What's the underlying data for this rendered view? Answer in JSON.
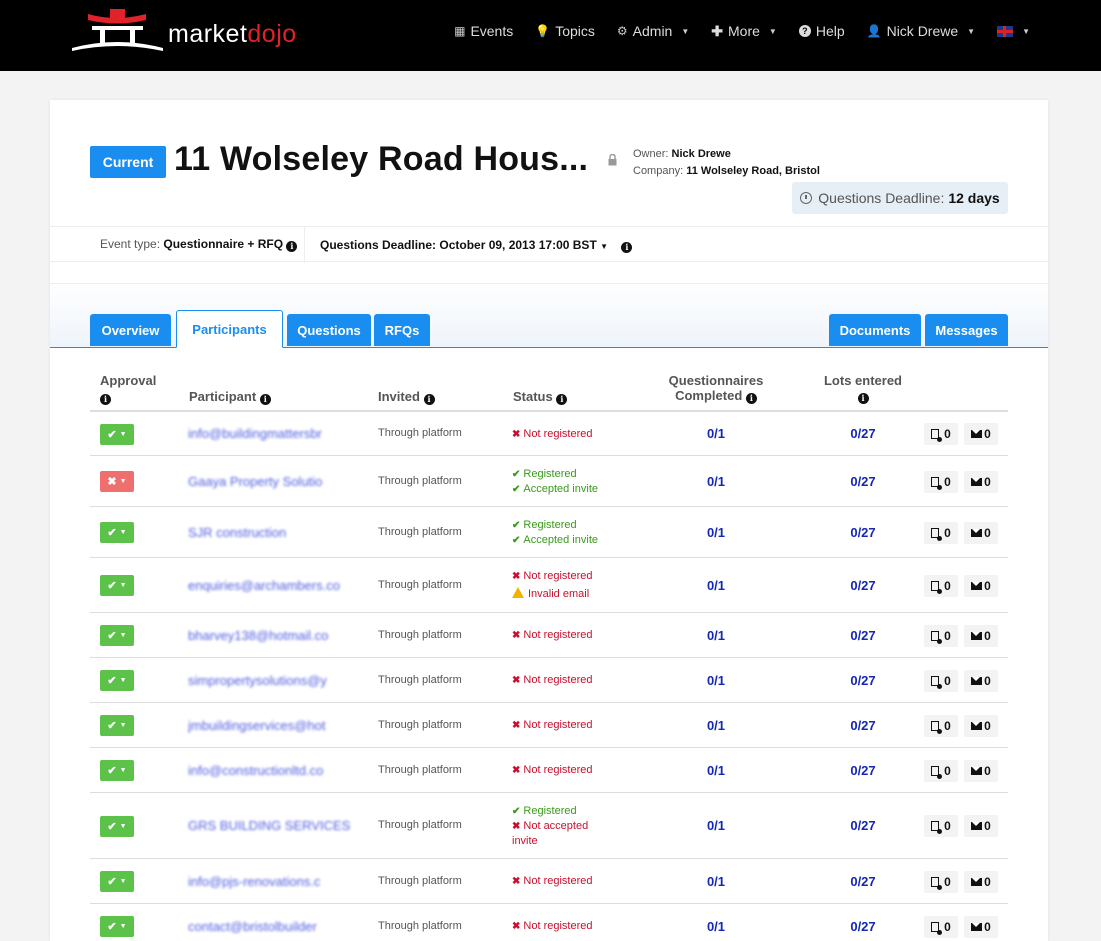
{
  "brand": {
    "name_part1": "market",
    "name_part2": "dojo"
  },
  "nav": {
    "events": "Events",
    "topics": "Topics",
    "admin": "Admin",
    "more": "More",
    "help": "Help",
    "user": "Nick Drewe"
  },
  "event": {
    "state_badge": "Current",
    "title": "11 Wolseley Road Hous...",
    "owner_label": "Owner:",
    "owner": "Nick Drewe",
    "company_label": "Company:",
    "company": "11 Wolseley Road, Bristol",
    "deadline_pill_label": "Questions Deadline:",
    "deadline_pill_value": "12 days",
    "type_label": "Event type:",
    "type_value": "Questionnaire + RFQ",
    "deadline_full": "Questions Deadline: October 09, 2013 17:00 BST"
  },
  "tabs": {
    "overview": "Overview",
    "participants": "Participants",
    "questions": "Questions",
    "rfqs": "RFQs",
    "documents": "Documents",
    "messages": "Messages"
  },
  "table": {
    "headers": {
      "approval": "Approval",
      "participant": "Participant",
      "invited": "Invited",
      "status": "Status",
      "questionnaires_1": "Questionnaires",
      "questionnaires_2": "Completed",
      "lots": "Lots entered"
    },
    "rows": [
      {
        "name": "info@buildingmattersbr",
        "invited": "Through platform",
        "status1": "Not registered",
        "status2": "",
        "status3": "",
        "q": "0/1",
        "lots": "0/27",
        "docs": "0",
        "msgs": "0"
      },
      {
        "name": "Gaaya Property Solutio",
        "invited": "Through platform",
        "status1": "Registered",
        "status2": "Accepted invite",
        "status3": "",
        "q": "0/1",
        "lots": "0/27",
        "docs": "0",
        "msgs": "0"
      },
      {
        "name": "SJR construction",
        "invited": "Through platform",
        "status1": "Registered",
        "status2": "Accepted invite",
        "status3": "",
        "q": "0/1",
        "lots": "0/27",
        "docs": "0",
        "msgs": "0"
      },
      {
        "name": "enquiries@archambers.co",
        "invited": "Through platform",
        "status1": "Not registered",
        "status2": "Invalid email",
        "status3": "",
        "q": "0/1",
        "lots": "0/27",
        "docs": "0",
        "msgs": "0"
      },
      {
        "name": "bharvey138@hotmail.co",
        "invited": "Through platform",
        "status1": "Not registered",
        "status2": "",
        "status3": "",
        "q": "0/1",
        "lots": "0/27",
        "docs": "0",
        "msgs": "0"
      },
      {
        "name": "simpropertysolutions@y",
        "invited": "Through platform",
        "status1": "Not registered",
        "status2": "",
        "status3": "",
        "q": "0/1",
        "lots": "0/27",
        "docs": "0",
        "msgs": "0"
      },
      {
        "name": "jmbuildingservices@hot",
        "invited": "Through platform",
        "status1": "Not registered",
        "status2": "",
        "status3": "",
        "q": "0/1",
        "lots": "0/27",
        "docs": "0",
        "msgs": "0"
      },
      {
        "name": "info@constructionltd.co",
        "invited": "Through platform",
        "status1": "Not registered",
        "status2": "",
        "status3": "",
        "q": "0/1",
        "lots": "0/27",
        "docs": "0",
        "msgs": "0"
      },
      {
        "name": "GRS BUILDING SERVICES",
        "invited": "Through platform",
        "status1": "Registered",
        "status2": "Not accepted",
        "status3": "invite",
        "q": "0/1",
        "lots": "0/27",
        "docs": "0",
        "msgs": "0"
      },
      {
        "name": "info@pjs-renovations.c",
        "invited": "Through platform",
        "status1": "Not registered",
        "status2": "",
        "status3": "",
        "q": "0/1",
        "lots": "0/27",
        "docs": "0",
        "msgs": "0"
      },
      {
        "name": "contact@bristolbuilder",
        "invited": "Through platform",
        "status1": "Not registered",
        "status2": "",
        "status3": "",
        "q": "0/1",
        "lots": "0/27",
        "docs": "0",
        "msgs": "0"
      }
    ]
  },
  "colors": {
    "accent": "#1a8ef0",
    "approve": "#5cc24a",
    "reject": "#ef6f6f",
    "error": "#c8102e",
    "success": "#3a9a1a",
    "link": "#1428b4"
  }
}
